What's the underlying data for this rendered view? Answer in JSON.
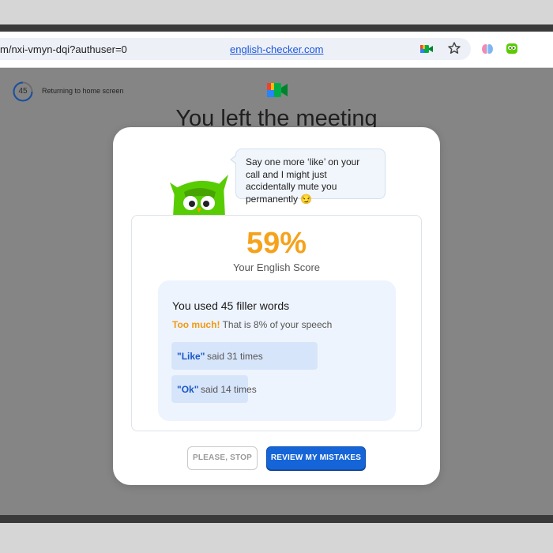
{
  "browser": {
    "url_path": "m/nxi-vmyn-dqi?authuser=0",
    "url_domain": "english-checker.com"
  },
  "background": {
    "countdown_value": "45",
    "returning_text": "Returning to home screen",
    "title": "You left the meeting"
  },
  "modal": {
    "bubble_text": "Say one more ‘like’ on your call and I might just accidentally mute you permanently 😏",
    "score_value": "59%",
    "score_label": "Your English Score",
    "filler_title": "You used 45 filler words",
    "too_much_label": "Too much!",
    "speech_share_text": "That is 8% of your speech",
    "filler_items": [
      {
        "word": "\"Like\"",
        "times": "said 31 times"
      },
      {
        "word": "\"Ok\"",
        "times": "said 14 times"
      }
    ],
    "stop_button": "PLEASE, STOP",
    "review_button": "REVIEW MY MISTAKES"
  },
  "colors": {
    "score": "#f5a21c",
    "too_much": "#f19a14",
    "primary_button": "#1565d8",
    "filler_box": "#eef4fd",
    "pill": "#d7e5fb"
  },
  "icons": [
    "meet-icon",
    "star-icon",
    "brain-extension-icon",
    "owl-extension-icon",
    "countdown-ring-icon",
    "google-meet-logo",
    "owl-mascot"
  ]
}
